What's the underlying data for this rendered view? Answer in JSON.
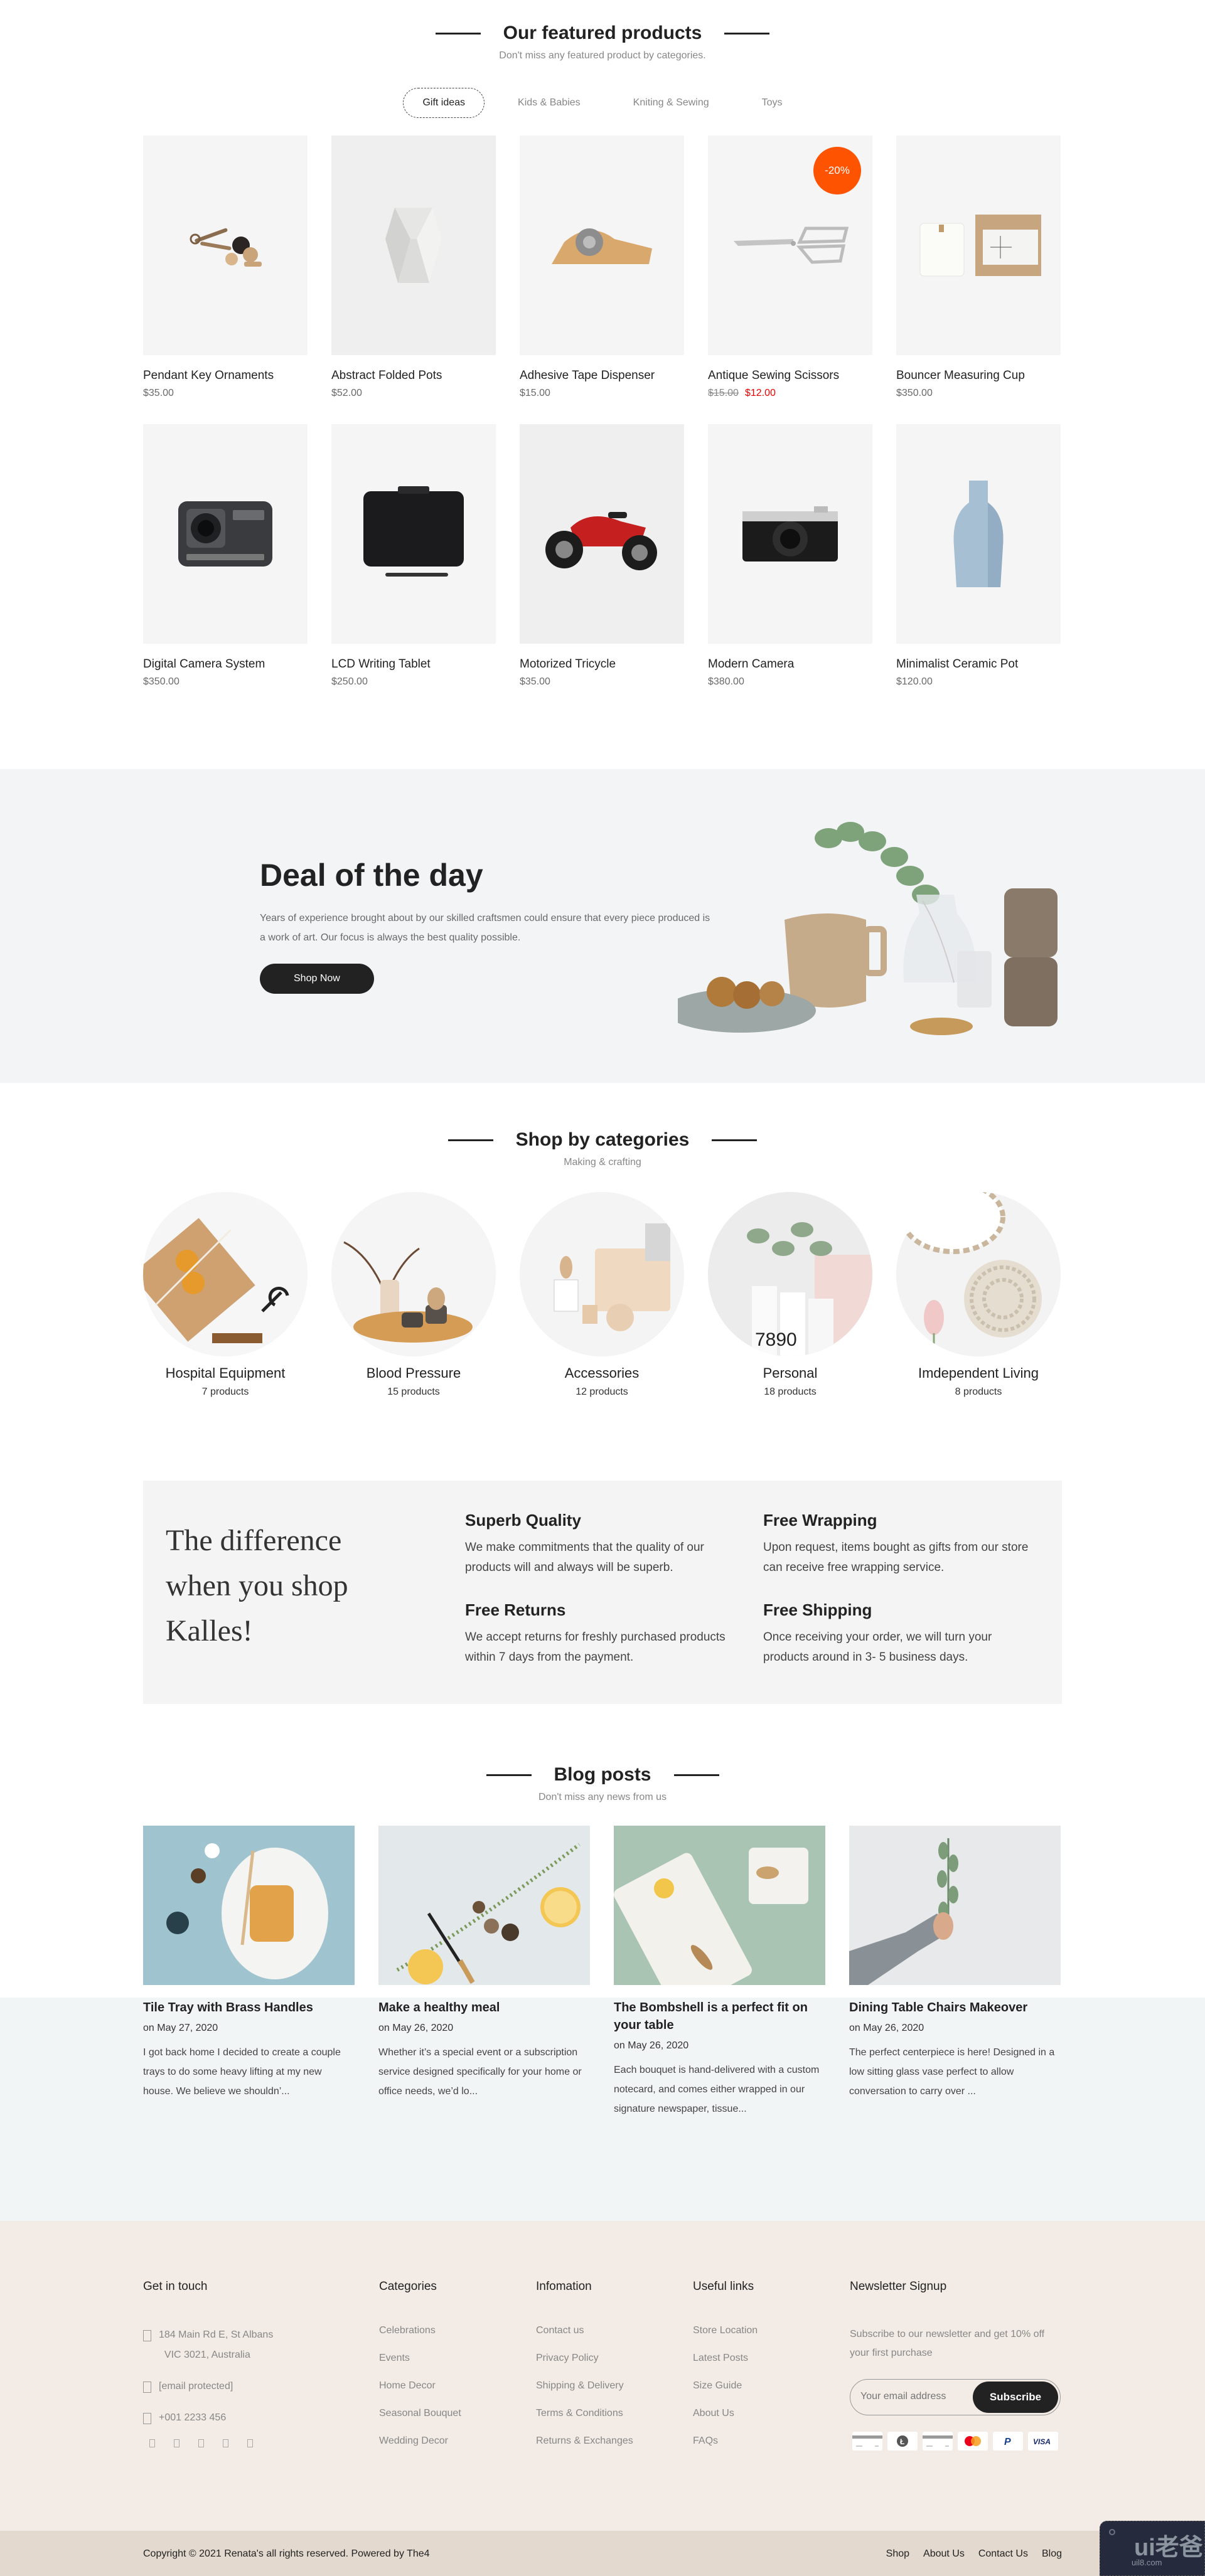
{
  "featured": {
    "title": "Our featured products",
    "subtitle": "Don't miss any featured product by categories.",
    "tabs": [
      {
        "label": "Gift ideas",
        "active": true
      },
      {
        "label": "Kids & Babies",
        "active": false
      },
      {
        "label": "Kniting & Sewing",
        "active": false
      },
      {
        "label": "Toys",
        "active": false
      }
    ],
    "products": [
      {
        "name": "Pendant Key Ornaments",
        "price": "$35.00",
        "image": "keys-icon"
      },
      {
        "name": "Abstract Folded Pots",
        "price": "$52.00",
        "image": "folded-pot-icon"
      },
      {
        "name": "Adhesive Tape Dispenser",
        "price": "$15.00",
        "image": "tape-dispenser-icon"
      },
      {
        "name": "Antique Sewing Scissors",
        "old_price": "$15.00",
        "price": "$12.00",
        "badge": "-20%",
        "image": "scissors-icon"
      },
      {
        "name": "Bouncer Measuring Cup",
        "price": "$350.00",
        "image": "candle-box-icon"
      },
      {
        "name": "Digital Camera System",
        "price": "$350.00",
        "image": "action-camera-icon"
      },
      {
        "name": "LCD Writing Tablet",
        "price": "$250.00",
        "image": "tablet-icon"
      },
      {
        "name": "Motorized Tricycle",
        "price": "$35.00",
        "image": "tricycle-icon"
      },
      {
        "name": "Modern Camera",
        "price": "$380.00",
        "image": "camera-icon"
      },
      {
        "name": "Minimalist Ceramic Pot",
        "price": "$120.00",
        "image": "vase-icon"
      }
    ]
  },
  "deal": {
    "title": "Deal of the day",
    "description": "Years of experience brought about by our skilled craftsmen could ensure that every piece produced is a work of art. Our focus is always the best quality possible.",
    "button": "Shop Now"
  },
  "categories": {
    "title": "Shop by categories",
    "subtitle": "Making & crafting",
    "items": [
      {
        "name": "Hospital Equipment",
        "count": "7 products"
      },
      {
        "name": "Blood Pressure",
        "count": "15 products"
      },
      {
        "name": "Accessories",
        "count": "12 products"
      },
      {
        "name": "Personal",
        "count": "18 products"
      },
      {
        "name": "Imdependent Living",
        "count": "8 products"
      }
    ]
  },
  "difference": {
    "headline": "The difference when you shop Kalles!",
    "features": [
      {
        "title": "Superb Quality",
        "text": "We make commitments that the quality of our products will and always will be superb."
      },
      {
        "title": "Free Wrapping",
        "text": "Upon request, items bought as gifts from our store can receive free wrapping service."
      },
      {
        "title": "Free Returns",
        "text": "We accept returns for freshly purchased products within 7 days from the payment."
      },
      {
        "title": "Free Shipping",
        "text": "Once receiving your order, we will turn your products around in 3- 5 business days."
      }
    ]
  },
  "blog": {
    "title": "Blog posts",
    "subtitle": "Don't miss any news from us",
    "posts": [
      {
        "title": "Tile Tray with Brass Handles",
        "date": "on May 27, 2020",
        "excerpt": "I got back home I decided to create a couple trays to do some heavy lifting at my new house. We believe we shouldn’..."
      },
      {
        "title": "Make a healthy meal",
        "date": "on May 26, 2020",
        "excerpt": "Whether it’s a special event or a subscription service designed specifically for your home or office needs, we’d lo..."
      },
      {
        "title": "The Bombshell is a perfect fit on your table",
        "date": "on May 26, 2020",
        "excerpt": "Each bouquet is hand-delivered with a custom notecard, and comes either wrapped in our signature newspaper, tissue..."
      },
      {
        "title": "Dining Table Chairs Makeover",
        "date": "on May 26, 2020",
        "excerpt": "The perfect centerpiece is here! Designed in a low sitting glass vase perfect to allow conversation to carry over ..."
      }
    ]
  },
  "footer": {
    "contact": {
      "title": "Get in touch",
      "address_line1": "184 Main Rd E, St Albans",
      "address_line2": "VIC 3021, Australia",
      "email": "[email protected]",
      "phone": "+001 2233 456",
      "socials": [
        "facebook-icon",
        "twitter-icon",
        "instagram-icon",
        "linkedin-icon",
        "pinterest-icon"
      ]
    },
    "categories": {
      "title": "Categories",
      "links": [
        "Celebrations",
        "Events",
        "Home Decor",
        "Seasonal Bouquet",
        "Wedding Decor"
      ]
    },
    "information": {
      "title": "Infomation",
      "links": [
        "Contact us",
        "Privacy Policy",
        "Shipping & Delivery",
        "Terms & Conditions",
        "Returns & Exchanges"
      ]
    },
    "useful": {
      "title": "Useful links",
      "links": [
        "Store Location",
        "Latest Posts",
        "Size Guide",
        "About Us",
        "FAQs"
      ]
    },
    "newsletter": {
      "title": "Newsletter Signup",
      "description": "Subscribe to our newsletter and get 10% off your first purchase",
      "placeholder": "Your email address",
      "button": "Subscribe",
      "payments": [
        "generic-card-icon",
        "litecoin-icon",
        "generic-card-icon",
        "mastercard-icon",
        "paypal-icon",
        "visa-icon"
      ]
    }
  },
  "bottom": {
    "copyright": "Copyright © 2021 Renata's all rights reserved. Powered by The4",
    "links": [
      "Shop",
      "About Us",
      "Contact Us",
      "Blog"
    ]
  },
  "watermark": {
    "brand": "ui老爸",
    "domain": "uil8.com"
  },
  "colors": {
    "accent_sale": "#fe5402",
    "price_sale": "#ec0101",
    "dark": "#222222",
    "footer_bg": "#f3ece6",
    "bottom_bg": "#e3d9ce"
  }
}
